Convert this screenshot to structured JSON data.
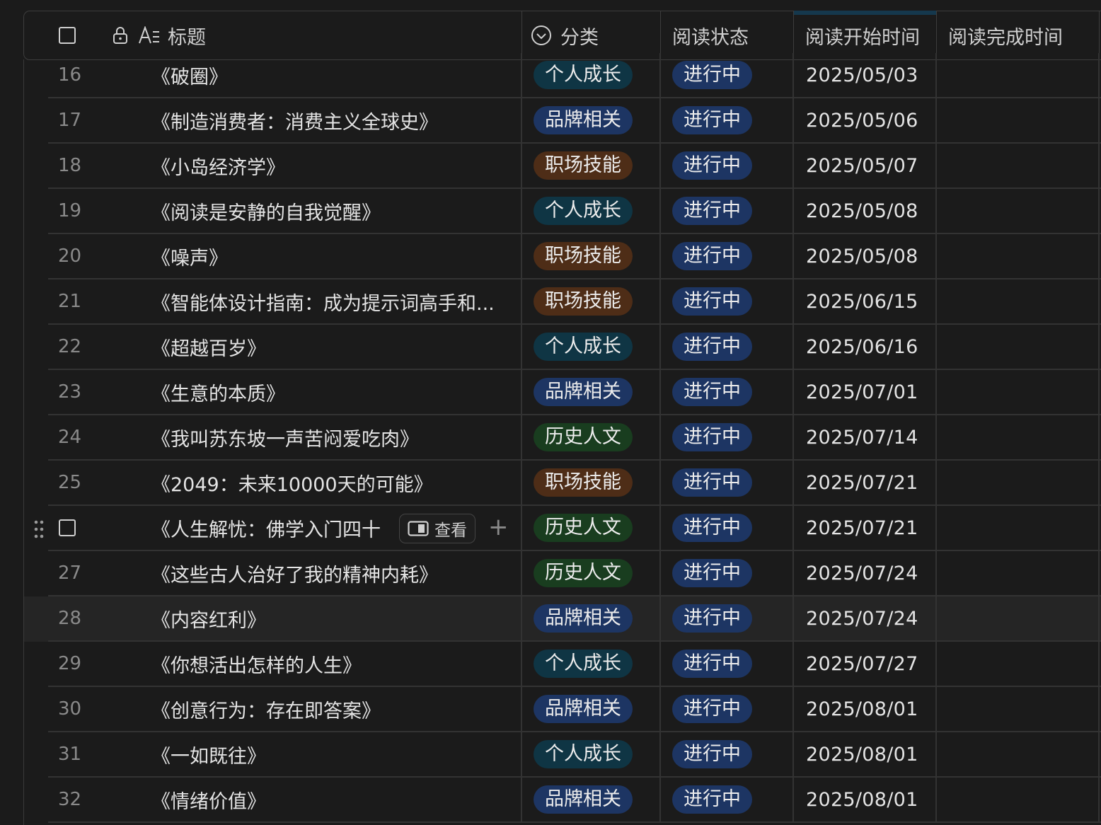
{
  "header": {
    "title_label": "标题",
    "category_label": "分类",
    "status_label": "阅读状态",
    "start_label": "阅读开始时间",
    "finish_label": "阅读完成时间"
  },
  "colors": {
    "个人成长": "#0f3544",
    "品牌相关": "#1d3563",
    "职场技能": "#4e2d17",
    "历史人文": "#193d1f",
    "进行中": "#1d3563"
  },
  "rows": [
    {
      "num": "16",
      "title": "《破圈》",
      "category": "个人成长",
      "status": "进行中",
      "start": "2025/05/03",
      "finish": ""
    },
    {
      "num": "17",
      "title": "《制造消费者：消费主义全球史》",
      "category": "品牌相关",
      "status": "进行中",
      "start": "2025/05/06",
      "finish": ""
    },
    {
      "num": "18",
      "title": "《小岛经济学》",
      "category": "职场技能",
      "status": "进行中",
      "start": "2025/05/07",
      "finish": ""
    },
    {
      "num": "19",
      "title": "《阅读是安静的自我觉醒》",
      "category": "个人成长",
      "status": "进行中",
      "start": "2025/05/08",
      "finish": ""
    },
    {
      "num": "20",
      "title": "《噪声》",
      "category": "职场技能",
      "status": "进行中",
      "start": "2025/05/08",
      "finish": ""
    },
    {
      "num": "21",
      "title": "《智能体设计指南：成为提示词高手和...",
      "category": "职场技能",
      "status": "进行中",
      "start": "2025/06/15",
      "finish": ""
    },
    {
      "num": "22",
      "title": "《超越百岁》",
      "category": "个人成长",
      "status": "进行中",
      "start": "2025/06/16",
      "finish": ""
    },
    {
      "num": "23",
      "title": "《生意的本质》",
      "category": "品牌相关",
      "status": "进行中",
      "start": "2025/07/01",
      "finish": ""
    },
    {
      "num": "24",
      "title": "《我叫苏东坡一声苦闷爱吃肉》",
      "category": "历史人文",
      "status": "进行中",
      "start": "2025/07/14",
      "finish": ""
    },
    {
      "num": "25",
      "title": "《2049：未来10000天的可能》",
      "category": "职场技能",
      "status": "进行中",
      "start": "2025/07/21",
      "finish": ""
    },
    {
      "num": "",
      "title": "《人生解忧：佛学入门四十",
      "category": "历史人文",
      "status": "进行中",
      "start": "2025/07/21",
      "finish": "",
      "hovered": true,
      "view_label": "查看"
    },
    {
      "num": "27",
      "title": "《这些古人治好了我的精神内耗》",
      "category": "历史人文",
      "status": "进行中",
      "start": "2025/07/24",
      "finish": ""
    },
    {
      "num": "28",
      "title": "《内容红利》",
      "category": "品牌相关",
      "status": "进行中",
      "start": "2025/07/24",
      "finish": "",
      "highlight": true
    },
    {
      "num": "29",
      "title": "《你想活出怎样的人生》",
      "category": "个人成长",
      "status": "进行中",
      "start": "2025/07/27",
      "finish": ""
    },
    {
      "num": "30",
      "title": "《创意行为：存在即答案》",
      "category": "品牌相关",
      "status": "进行中",
      "start": "2025/08/01",
      "finish": ""
    },
    {
      "num": "31",
      "title": "《一如既往》",
      "category": "个人成长",
      "status": "进行中",
      "start": "2025/08/01",
      "finish": ""
    },
    {
      "num": "32",
      "title": "《情绪价值》",
      "category": "品牌相关",
      "status": "进行中",
      "start": "2025/08/01",
      "finish": ""
    }
  ]
}
